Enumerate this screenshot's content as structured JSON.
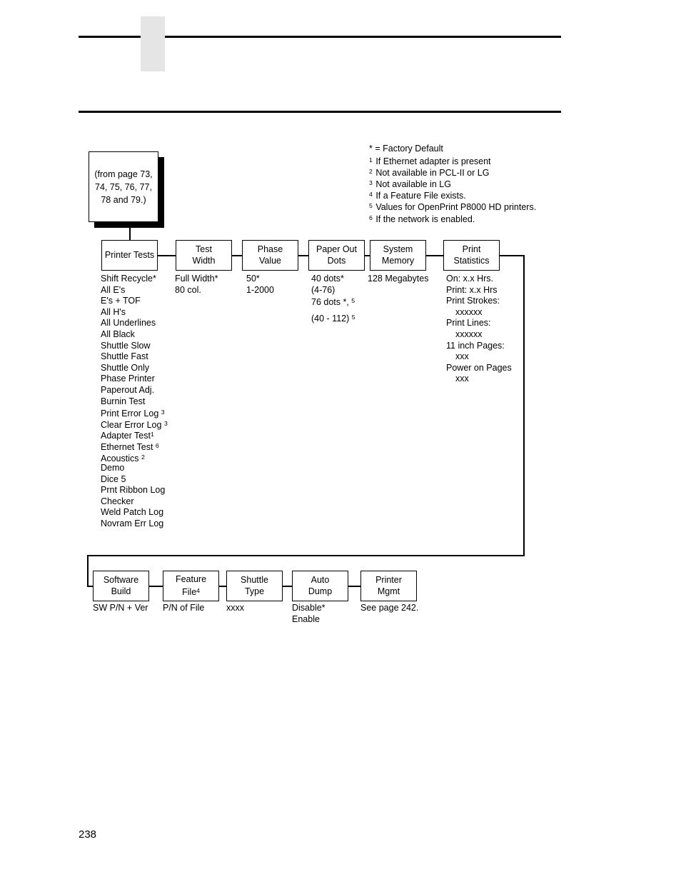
{
  "page": {
    "number": "238"
  },
  "legend": {
    "lines": [
      {
        "marker": "*",
        "text": "= Factory Default",
        "marker_sup": false
      },
      {
        "marker": "1",
        "text": "If Ethernet adapter is present",
        "marker_sup": true
      },
      {
        "marker": "2",
        "text": "Not available in PCL-II or LG",
        "marker_sup": true
      },
      {
        "marker": "3",
        "text": "Not available in LG",
        "marker_sup": true
      },
      {
        "marker": "4",
        "text": "If a Feature File exists.",
        "marker_sup": true
      },
      {
        "marker": "5",
        "text": "Values for OpenPrint P8000 HD printers.",
        "marker_sup": true
      },
      {
        "marker": "6",
        "text": "If the network is enabled.",
        "marker_sup": true
      }
    ]
  },
  "from_page_box": {
    "line1": "(from page 73,",
    "line2": "74, 75, 76, 77,",
    "line3": "78 and 79.)"
  },
  "menu": {
    "top_row": [
      {
        "id": "printer-tests",
        "line1": "Printer Tests",
        "line2": ""
      },
      {
        "id": "test-width",
        "line1": "Test",
        "line2": "Width"
      },
      {
        "id": "phase-value",
        "line1": "Phase",
        "line2": "Value"
      },
      {
        "id": "paper-out-dots",
        "line1": "Paper Out",
        "line2": "Dots"
      },
      {
        "id": "system-memory",
        "line1": "System",
        "line2": "Memory"
      },
      {
        "id": "print-statistics",
        "line1": "Print",
        "line2": "Statistics"
      }
    ],
    "bottom_row": [
      {
        "id": "software-build",
        "line1": "Software",
        "line2": "Build"
      },
      {
        "id": "feature-file",
        "line1": "Feature",
        "line2": "File",
        "sup": "4"
      },
      {
        "id": "shuttle-type",
        "line1": "Shuttle",
        "line2": "Type"
      },
      {
        "id": "auto-dump",
        "line1": "Auto",
        "line2": "Dump"
      },
      {
        "id": "printer-mgmt",
        "line1": "Printer",
        "line2": "Mgmt"
      }
    ]
  },
  "options": {
    "printer_tests": [
      {
        "text": "Shift Recycle*"
      },
      {
        "text": "All E's"
      },
      {
        "text": "E's + TOF"
      },
      {
        "text": "All H's"
      },
      {
        "text": "All Underlines"
      },
      {
        "text": "All Black"
      },
      {
        "text": "Shuttle Slow"
      },
      {
        "text": "Shuttle Fast"
      },
      {
        "text": "Shuttle Only"
      },
      {
        "text": "Phase Printer"
      },
      {
        "text": "Paperout Adj."
      },
      {
        "text": "Burnin Test"
      },
      {
        "text": "Print Error Log",
        "sup": "3",
        "sup_space": true
      },
      {
        "text": "Clear Error Log",
        "sup": "3",
        "sup_space": true
      },
      {
        "text": "Adapter Test",
        "sup": "1",
        "sup_space": false
      },
      {
        "text": "Ethernet Test",
        "sup": "6",
        "sup_space": true
      },
      {
        "text": "Acoustics",
        "sup": "2",
        "sup_space": true
      },
      {
        "text": "Demo"
      },
      {
        "text": "Dice 5"
      },
      {
        "text": "Prnt Ribbon Log"
      },
      {
        "text": "Checker"
      },
      {
        "text": "Weld Patch Log"
      },
      {
        "text": "Novram Err Log"
      }
    ],
    "test_width": [
      {
        "text": "Full Width*"
      },
      {
        "text": "80 col."
      }
    ],
    "phase_value": [
      {
        "text": "50*"
      },
      {
        "text": "1-2000"
      }
    ],
    "paper_out_dots": [
      {
        "text": "40 dots*"
      },
      {
        "text": "(4-76)"
      },
      {
        "text": "76 dots *,",
        "sup": "5",
        "sup_space": true,
        "gap": true
      },
      {
        "text": "(40 - 112)",
        "sup": "5",
        "sup_space": true
      }
    ],
    "system_memory": [
      {
        "text": "128 Megabytes"
      }
    ],
    "print_statistics": [
      {
        "text": "On: x.x Hrs."
      },
      {
        "text": "Print: x.x Hrs"
      },
      {
        "text": "Print Strokes:"
      },
      {
        "text": "xxxxxx",
        "indent": true
      },
      {
        "text": "Print Lines:"
      },
      {
        "text": "xxxxxx",
        "indent": true
      },
      {
        "text": "11 inch Pages:"
      },
      {
        "text": "xxx",
        "indent": true
      },
      {
        "text": "Power on Pages"
      },
      {
        "text": "xxx",
        "indent": true
      }
    ],
    "software_build": [
      {
        "text": "SW P/N + Ver"
      }
    ],
    "feature_file": [
      {
        "text": "P/N of File"
      }
    ],
    "shuttle_type": [
      {
        "text": "xxxx"
      }
    ],
    "auto_dump": [
      {
        "text": "Disable*"
      },
      {
        "text": "Enable"
      }
    ],
    "printer_mgmt": [
      {
        "text": "See page 242."
      }
    ]
  }
}
